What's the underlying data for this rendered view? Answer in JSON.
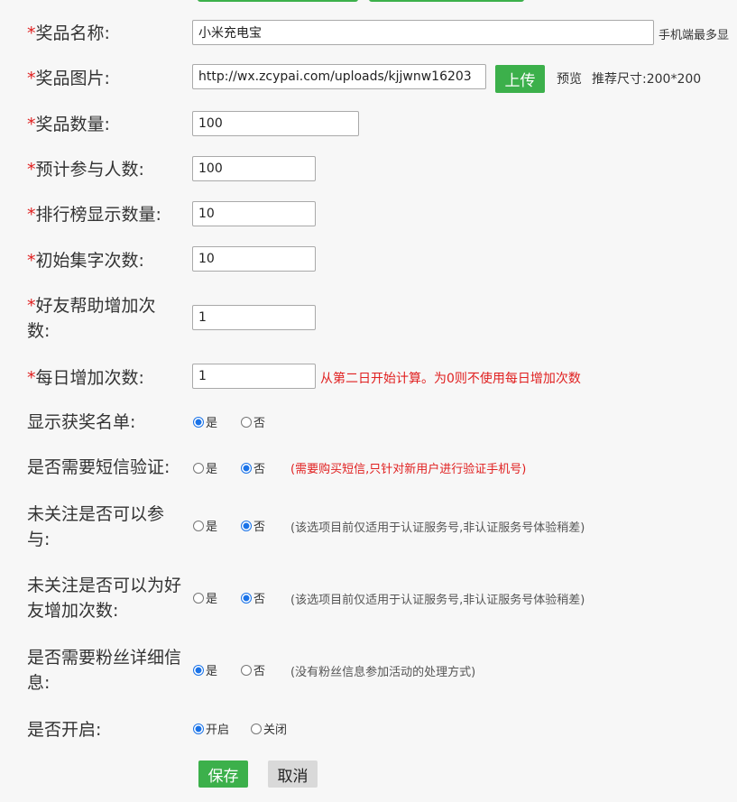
{
  "form": {
    "required_mark": "*",
    "prize_name": {
      "label": "奖品名称:",
      "value": "小米充电宝",
      "hint": "手机端最多显"
    },
    "prize_image": {
      "label": "奖品图片:",
      "value": "http://wx.zcypai.com/uploads/kjjwnw16203",
      "upload_label": "上传",
      "preview_label": "预览",
      "size_hint": "推荐尺寸:200*200"
    },
    "prize_quantity": {
      "label": "奖品数量:",
      "value": "100"
    },
    "expected_participants": {
      "label": "预计参与人数:",
      "value": "100"
    },
    "leaderboard_count": {
      "label": "排行榜显示数量:",
      "value": "10"
    },
    "initial_collect_count": {
      "label": "初始集字次数:",
      "value": "10"
    },
    "friend_help_count": {
      "label": "好友帮助增加次数:",
      "value": "1"
    },
    "daily_increase": {
      "label": "每日增加次数:",
      "value": "1",
      "hint": "从第二日开始计算。为0则不使用每日增加次数"
    },
    "show_winners": {
      "label": "显示获奖名单:",
      "yes": "是",
      "no": "否",
      "selected": "yes"
    },
    "sms_verify": {
      "label": "是否需要短信验证:",
      "yes": "是",
      "no": "否",
      "selected": "no",
      "hint": "(需要购买短信,只针对新用户进行验证手机号)"
    },
    "unfollowed_join": {
      "label": "未关注是否可以参与:",
      "yes": "是",
      "no": "否",
      "selected": "no",
      "hint": "(该选项目前仅适用于认证服务号,非认证服务号体验稍差)"
    },
    "unfollowed_help": {
      "label": "未关注是否可以为好友增加次数:",
      "yes": "是",
      "no": "否",
      "selected": "no",
      "hint": "(该选项目前仅适用于认证服务号,非认证服务号体验稍差)"
    },
    "fan_details": {
      "label": "是否需要粉丝详细信息:",
      "yes": "是",
      "no": "否",
      "selected": "yes",
      "hint": "(没有粉丝信息参加活动的处理方式)"
    },
    "enabled": {
      "label": "是否开启:",
      "on": "开启",
      "off": "关闭",
      "selected": "on"
    }
  },
  "actions": {
    "save_label": "保存",
    "cancel_label": "取消"
  },
  "colors": {
    "accent_green": "#3cb04b",
    "required_red": "#e02020",
    "radio_blue": "#1a73e8",
    "background": "#f7f7f7"
  }
}
